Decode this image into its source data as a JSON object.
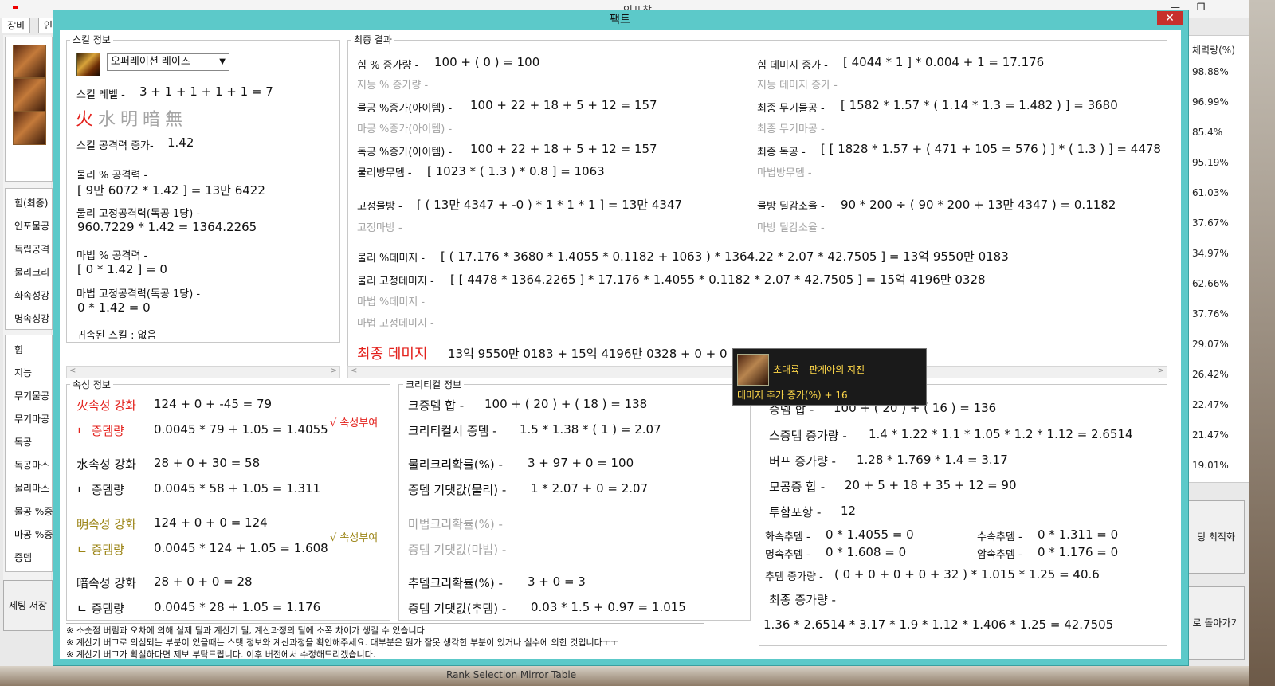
{
  "background_window": {
    "title": "인포창",
    "minimize": "—",
    "maximize": "❐",
    "tabs": [
      "장비",
      "인"
    ],
    "left_labels": [
      "힘(최종)",
      "인포물공",
      "독립공격",
      "물리크리",
      "화속성강",
      "명속성강",
      "힘",
      "지능",
      "무기물공",
      "무기마공",
      "독공",
      "독공마스",
      "물리마스",
      "물공 %증",
      "마공 %증",
      "증뎀"
    ],
    "save_button": "세팅 저장",
    "right_header": "체력량(%)",
    "right_values": [
      "98.88%",
      "96.99%",
      "85.4%",
      "95.19%",
      "61.03%",
      "37.67%",
      "34.97%",
      "62.66%",
      "37.76%",
      "29.07%",
      "26.42%",
      "22.47%",
      "21.47%",
      "19.01%"
    ],
    "right_button1": "팅 최적화",
    "right_button2": "로 돌아가기",
    "bottom_text": "Rank Selection Mirror Table"
  },
  "modal": {
    "title": "팩트",
    "close": "✕"
  },
  "skill_info": {
    "label": "스킬 정보",
    "skill_select": "오퍼레이션 레이즈",
    "level_label": "스킬 레벨 -",
    "level_value": "3 + 1 + 1 + 1 + 1 = 7",
    "elements": [
      "火",
      "水",
      "明",
      "暗",
      "無"
    ],
    "atk_inc_label": "스킬 공격력 증가-",
    "atk_inc_value": "1.42",
    "phys_pct_label": "물리 % 공격력 -",
    "phys_pct_value": "[ 9만 6072 * 1.42 ] = 13만 6422",
    "phys_fixed_label": "물리 고정공격력(독공 1당) -",
    "phys_fixed_value": "960.7229 * 1.42 = 1364.2265",
    "mag_pct_label": "마법 % 공격력 -",
    "mag_pct_value": "[ 0 * 1.42 ] = 0",
    "mag_fixed_label": "마법 고정공격력(독공 1당) -",
    "mag_fixed_value": "0 * 1.42 = 0",
    "bound_skill": "귀속된 스킬 : 없음"
  },
  "final_result": {
    "label": "최종 결과",
    "left": [
      {
        "label": "힘 % 증가량 -",
        "value": "100 + ( 0 ) = 100",
        "dim": false
      },
      {
        "label": "지능 % 증가량 -",
        "value": "",
        "dim": true
      },
      {
        "label": "물공 %증가(아이템) -",
        "value": "100 + 22 + 18 + 5 + 12 = 157",
        "dim": false
      },
      {
        "label": "마공 %증가(아이템) -",
        "value": "",
        "dim": true
      },
      {
        "label": "독공 %증가(아이템) -",
        "value": "100 + 22 + 18 + 5 + 12 = 157",
        "dim": false
      },
      {
        "label": "물리방무뎀 -",
        "value": "[ 1023 * ( 1.3 ) * 0.8 ] = 1063",
        "dim": false
      },
      {
        "label": "고정물방 -",
        "value": "[ ( 13만 4347 + -0 ) * 1 * 1 * 1 ] = 13만 4347",
        "dim": false
      },
      {
        "label": "고정마방 -",
        "value": "",
        "dim": true
      }
    ],
    "right": [
      {
        "label": "힘 데미지 증가 -",
        "value": "[ 4044 * 1 ] * 0.004 + 1 = 17.176",
        "dim": false
      },
      {
        "label": "지능 데미지 증가 -",
        "value": "",
        "dim": true
      },
      {
        "label": "최종 무기물공 -",
        "value": "[ 1582 * 1.57 * ( 1.14 * 1.3 = 1.482 ) ] = 3680",
        "dim": false
      },
      {
        "label": "최종 무기마공 -",
        "value": "",
        "dim": true
      },
      {
        "label": "최종 독공 -",
        "value": "[ [ 1828 * 1.57 + ( 471 + 105 = 576 ) ] * ( 1.3 ) ] = 4478",
        "dim": false
      },
      {
        "label": "마법방무뎀 -",
        "value": "",
        "dim": true
      },
      {
        "label": "물방 딜감소율 -",
        "value": "90 * 200 ÷ ( 90 * 200 + 13만 4347 ) = 0.1182",
        "dim": false
      },
      {
        "label": "마방 딜감소율 -",
        "value": "",
        "dim": true
      }
    ],
    "phys_pct_dmg_label": "물리 %데미지 -",
    "phys_pct_dmg_value": "[ ( 17.176 * 3680 * 1.4055 * 0.1182 + 1063 ) * 1364.22 * 2.07 * 42.7505 ] = 13억 9550만 0183",
    "phys_fixed_dmg_label": "물리 고정데미지 -",
    "phys_fixed_dmg_value": "[ [ 4478 * 1364.2265 ] * 17.176 * 1.4055 * 0.1182 * 2.07 * 42.7505 ] = 15억 4196만 0328",
    "mag_pct_dmg_label": "마법 %데미지 -",
    "mag_fixed_dmg_label": "마법 고정데미지 -",
    "final_damage_label": "최종 데미지",
    "final_damage_value": "13억 9550만 0183 + 15억 4196만 0328 + 0 + 0 + 0 ="
  },
  "tooltip": {
    "title": "초대륙 - 판게아의 지진",
    "line": "데미지 추가 증가(%) + 16"
  },
  "element_info": {
    "label": "속성 정보",
    "rows": [
      {
        "name": "火속성 강화",
        "value": "124 + 0 + -45 = 79",
        "color": "#e3211c",
        "dmg_label": "ㄴ 증뎀량",
        "dmg_value": "0.0045 * 79 + 1.05 = 1.4055",
        "badge": "√ 속성부여"
      },
      {
        "name": "水속성 강화",
        "value": "28 + 0 + 30 = 58",
        "color": "#111111",
        "dmg_label": "ㄴ 증뎀량",
        "dmg_value": "0.0045 * 58 + 1.05 = 1.311",
        "badge": ""
      },
      {
        "name": "明속성 강화",
        "value": "124 + 0 + 0 = 124",
        "color": "#9b8415",
        "dmg_label": "ㄴ 증뎀량",
        "dmg_value": "0.0045 * 124 + 1.05 = 1.608",
        "badge": "√ 속성부여"
      },
      {
        "name": "暗속성 강화",
        "value": "28 + 0 + 0 = 28",
        "color": "#111111",
        "dmg_label": "ㄴ 증뎀량",
        "dmg_value": "0.0045 * 28 + 1.05 = 1.176",
        "badge": ""
      }
    ]
  },
  "critical_info": {
    "label": "크리티컬 정보",
    "rows": [
      {
        "label": "크증뎀 합 -",
        "value": "100 + ( 20 ) + ( 18 ) = 138",
        "dim": false
      },
      {
        "label": "크리티컬시 증뎀 -",
        "value": "1.5 * 1.38 * ( 1 ) = 2.07",
        "dim": false
      },
      {
        "label": "물리크리확률(%) -",
        "value": "3 + 97 + 0 = 100",
        "dim": false
      },
      {
        "label": "증뎀 기댓값(물리) -",
        "value": "1 * 2.07 + 0 = 2.07",
        "dim": false
      },
      {
        "label": "마법크리확률(%) -",
        "value": "",
        "dim": true
      },
      {
        "label": "증뎀 기댓값(마법) -",
        "value": "",
        "dim": true
      },
      {
        "label": "추뎀크리확률(%) -",
        "value": "3 + 0 = 3",
        "dim": false
      },
      {
        "label": "증뎀 기댓값(추뎀) -",
        "value": "0.03 * 1.5 + 0.97 = 1.015",
        "dim": false
      }
    ]
  },
  "multiplier_info": {
    "rows": [
      {
        "label": "증뎀 합 -",
        "value": "100 + ( 20 ) + ( 16 ) = 136"
      },
      {
        "label": "스증뎀 증가량 -",
        "value": "1.4 * 1.22 * 1.1 * 1.05 * 1.2 * 1.12 = 2.6514"
      },
      {
        "label": "버프 증가량 -",
        "value": "1.28 * 1.769 * 1.4 = 3.17"
      },
      {
        "label": "모공증 합 -",
        "value": "20 + 5 + 18 + 35 + 12 = 90"
      },
      {
        "label": "투함포항 -",
        "value": "12"
      }
    ],
    "add_dmg": [
      {
        "label": "화속추뎀 -",
        "value": "0 * 1.4055 = 0"
      },
      {
        "label": "수속추뎀 -",
        "value": "0 * 1.311 = 0"
      },
      {
        "label": "명속추뎀 -",
        "value": "0 * 1.608 = 0"
      },
      {
        "label": "암속추뎀 -",
        "value": "0 * 1.176 = 0"
      }
    ],
    "add_inc_label": "추뎀 증가량 -",
    "add_inc_value": "( 0 + 0 + 0 + 0 + 32 ) * 1.015 * 1.25 = 40.6",
    "final_inc_label": "최종 증가량 -",
    "final_inc_value": "1.36 * 2.6514 * 3.17 * 1.9 * 1.12 * 1.406 * 1.25 = 42.7505"
  },
  "notes": [
    "※ 소숫점 버림과 오차에 의해 실제 딜과 계산기 딜, 계산과정의 딜에 소폭 차이가 생길 수 있습니다",
    "※ 계산기 버그로 의심되는 부분이 있을때는 스탯 정보와 계산과정을 확인해주세요. 대부분은 뭔가 잘못 생각한 부분이 있거나 실수에 의한 것입니다ㅜㅜ",
    "※ 계산기 버그가 확실하다면 제보 부탁드립니다. 이후 버전에서 수정해드리겠습니다."
  ]
}
